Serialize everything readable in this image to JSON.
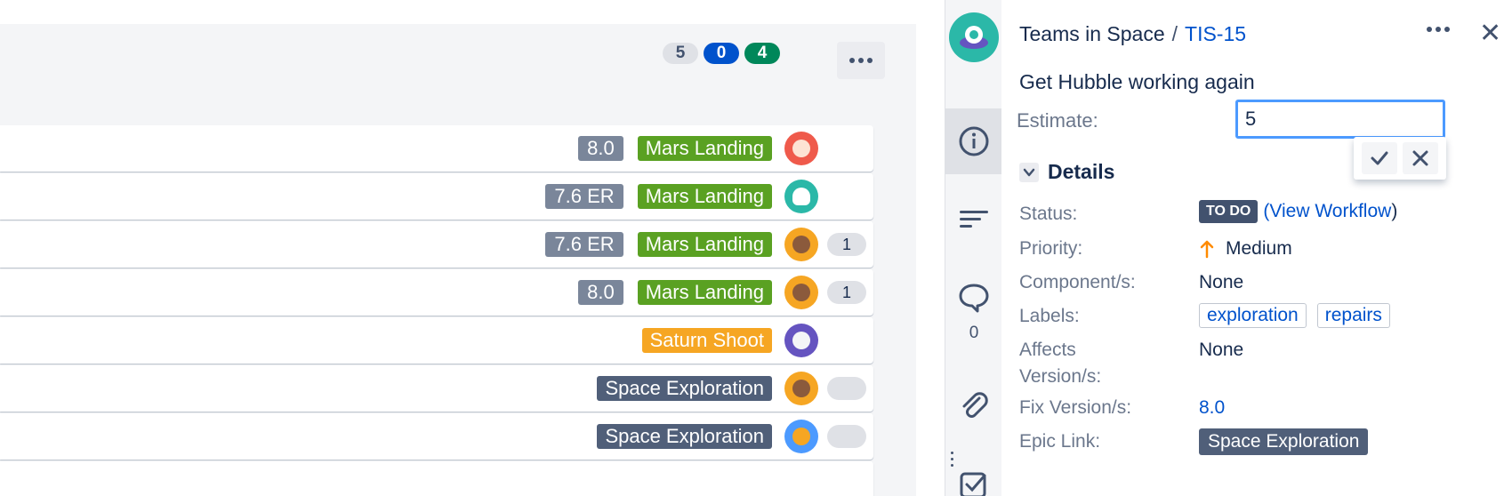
{
  "board": {
    "counts": [
      {
        "value": "5",
        "color": "#dfe1e6"
      },
      {
        "value": "0",
        "color": "#0052cc"
      },
      {
        "value": "4",
        "color": "#00875a"
      }
    ],
    "more_icon": "more-horizontal-icon",
    "rows": [
      {
        "version": "8.0",
        "epic": "Mars Landing",
        "epic_color": "#5aa122",
        "avatar_color": "#ef5a4b",
        "subtasks": ""
      },
      {
        "version": "7.6 ER",
        "epic": "Mars Landing",
        "epic_color": "#5aa122",
        "avatar_color": "#2bb8a8",
        "subtasks": ""
      },
      {
        "version": "7.6 ER",
        "epic": "Mars Landing",
        "epic_color": "#5aa122",
        "avatar_color": "#f6a623",
        "subtasks": "1"
      },
      {
        "version": "8.0",
        "epic": "Mars Landing",
        "epic_color": "#5aa122",
        "avatar_color": "#f6a623",
        "subtasks": "1"
      },
      {
        "version": "",
        "epic": "Saturn Shoot",
        "epic_color": "#f6a623",
        "avatar_color": "#6554c0",
        "subtasks": ""
      },
      {
        "version": "",
        "epic": "Space Exploration",
        "epic_color": "#505f79",
        "avatar_color": "#f6a623",
        "subtasks": ""
      },
      {
        "version": "",
        "epic": "Space Exploration",
        "epic_color": "#505f79",
        "avatar_color": "#4c9aff",
        "subtasks": ""
      }
    ]
  },
  "rail": {
    "project_avatar_icon": "project-avatar-icon",
    "items": [
      "info-icon",
      "description-icon",
      "comment-icon",
      "attachment-icon",
      "subtasks-icon"
    ],
    "comment_count": "0"
  },
  "issue": {
    "project": "Teams in Space",
    "separator": "/",
    "key": "TIS-15",
    "summary": "Get Hubble working again",
    "estimate_label": "Estimate:",
    "estimate_value": "5",
    "details_title": "Details",
    "fields": {
      "status_label": "Status:",
      "status_value": "TO DO",
      "status_link_open": "(",
      "status_link": "View Workflow",
      "status_link_close": ")",
      "priority_label": "Priority:",
      "priority_value": "Medium",
      "priority_color": "#ff8b00",
      "components_label": "Component/s:",
      "components_value": "None",
      "labels_label": "Labels:",
      "labels": [
        "exploration",
        "repairs"
      ],
      "affects_label_1": "Affects",
      "affects_label_2": "Version/s:",
      "affects_value": "None",
      "fix_label": "Fix Version/s:",
      "fix_value": "8.0",
      "epic_label": "Epic Link:",
      "epic_value": "Space Exploration"
    }
  }
}
